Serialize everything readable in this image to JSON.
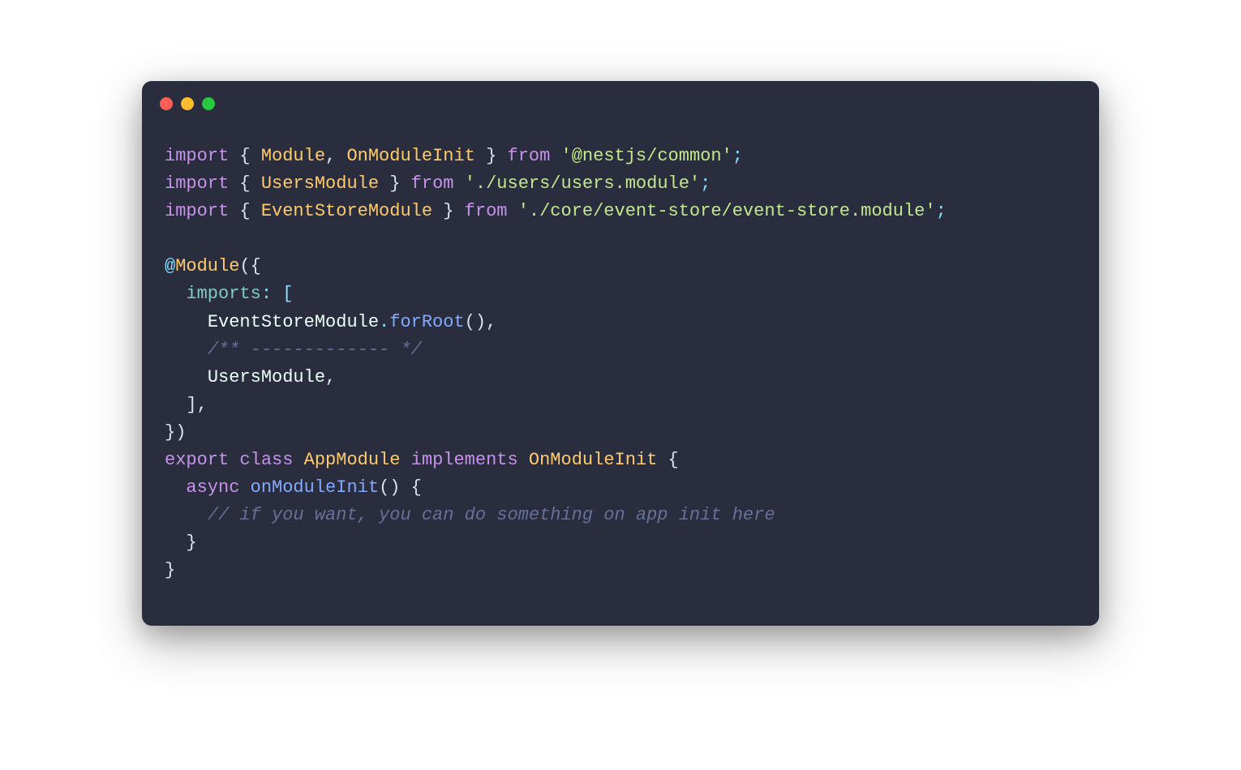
{
  "titlebar": {
    "buttons": [
      "close",
      "minimize",
      "zoom"
    ]
  },
  "code": {
    "line1": {
      "import": "import",
      "lbrace": " { ",
      "Module": "Module",
      "comma1": ", ",
      "OnModuleInit": "OnModuleInit",
      "rbrace": " } ",
      "from": "from",
      "sp": " ",
      "pkg": "'@nestjs/common'",
      "semi": ";"
    },
    "line2": {
      "import": "import",
      "lbrace": " { ",
      "UsersModule": "UsersModule",
      "rbrace": " } ",
      "from": "from",
      "sp": " ",
      "pkg": "'./users/users.module'",
      "semi": ";"
    },
    "line3": {
      "import": "import",
      "lbrace": " { ",
      "EventStoreModule": "EventStoreModule",
      "rbrace": " } ",
      "from": "from",
      "sp": " ",
      "pkg": "'./core/event-store/event-store.module'",
      "semi": ";"
    },
    "blank1": "",
    "line5": {
      "at": "@",
      "Module": "Module",
      "open": "({"
    },
    "line6": {
      "indent": "  ",
      "imports": "imports",
      "punct": ": ["
    },
    "line7": {
      "indent": "    ",
      "EventStoreModule": "EventStoreModule",
      "dot": ".",
      "forRoot": "forRoot",
      "parens": "(),"
    },
    "line8": {
      "indent": "    ",
      "comment": "/** ------------- */"
    },
    "line9": {
      "indent": "    ",
      "UsersModule": "UsersModule",
      "comma": ","
    },
    "line10": {
      "indent": "  ",
      "close": "],"
    },
    "line11": {
      "close": "})"
    },
    "line12": {
      "export": "export",
      "sp1": " ",
      "class": "class",
      "sp2": " ",
      "AppModule": "AppModule",
      "sp3": " ",
      "implements": "implements",
      "sp4": " ",
      "OnModuleInit": "OnModuleInit",
      "sp5": " ",
      "lbrace": "{"
    },
    "line13": {
      "indent": "  ",
      "async": "async",
      "sp": " ",
      "onModuleInit": "onModuleInit",
      "parens": "()",
      "sp2": " ",
      "lbrace": "{"
    },
    "line14": {
      "indent": "    ",
      "comment": "// if you want, you can do something on app init here"
    },
    "line15": {
      "indent": "  ",
      "rbrace": "}"
    },
    "line16": {
      "rbrace": "}"
    }
  }
}
